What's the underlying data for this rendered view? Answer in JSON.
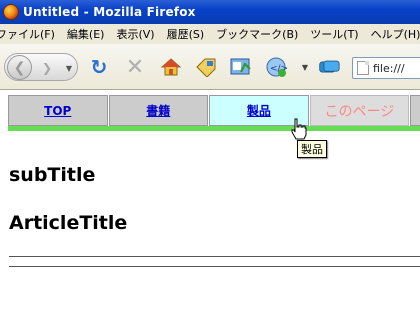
{
  "window": {
    "title": "Untitled - Mozilla Firefox"
  },
  "menu": {
    "items": [
      {
        "label": "ファイル(F)"
      },
      {
        "label": "編集(E)"
      },
      {
        "label": "表示(V)"
      },
      {
        "label": "履歴(S)"
      },
      {
        "label": "ブックマーク(B)"
      },
      {
        "label": "ツール(T)"
      },
      {
        "label": "ヘルプ(H)"
      }
    ]
  },
  "toolbar": {
    "back_icon": "back-arrow-icon",
    "forward_icon": "forward-arrow-icon",
    "reload_icon": "reload-icon",
    "stop_icon": "stop-icon",
    "home_icon": "home-icon",
    "address_text": "file:///"
  },
  "page": {
    "nav": {
      "tabs": [
        {
          "label": "TOP"
        },
        {
          "label": "書籍"
        },
        {
          "label": "製品"
        },
        {
          "label": "このページ"
        }
      ]
    },
    "tooltip": "製品",
    "subtitle": "subTitle",
    "article_title": "ArticleTitle"
  },
  "colors": {
    "nav_underline": "#66dd55",
    "active_tab_bg": "#ccffff",
    "current_tab_text": "#ff8888",
    "link": "#0000cc"
  }
}
